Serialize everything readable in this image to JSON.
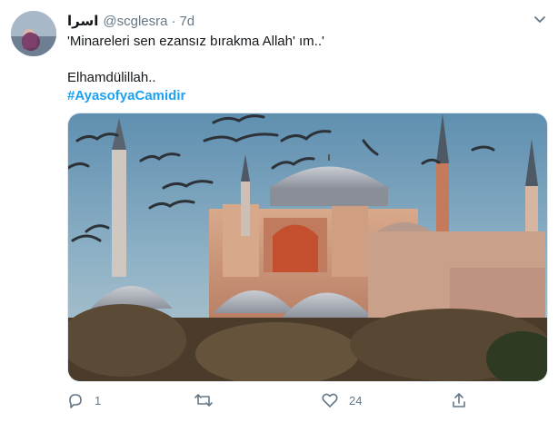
{
  "tweet": {
    "display_name": "اسرا",
    "handle": "@scglesra",
    "separator": "·",
    "time": "7d",
    "text_line1": "'Minareleri sen ezansız bırakma Allah' ım..'",
    "text_line2": "Elhamdülillah..",
    "hashtag": "#AyasofyaCamidir"
  },
  "actions": {
    "reply_count": "1",
    "retweet_count": "",
    "like_count": "24"
  },
  "icons": {
    "reply": "reply-icon",
    "retweet": "retweet-icon",
    "like": "heart-icon",
    "share": "share-icon",
    "menu": "chevron-down-icon"
  },
  "colors": {
    "link": "#1da1f2",
    "secondary_text": "#657786",
    "primary_text": "#14171a"
  }
}
